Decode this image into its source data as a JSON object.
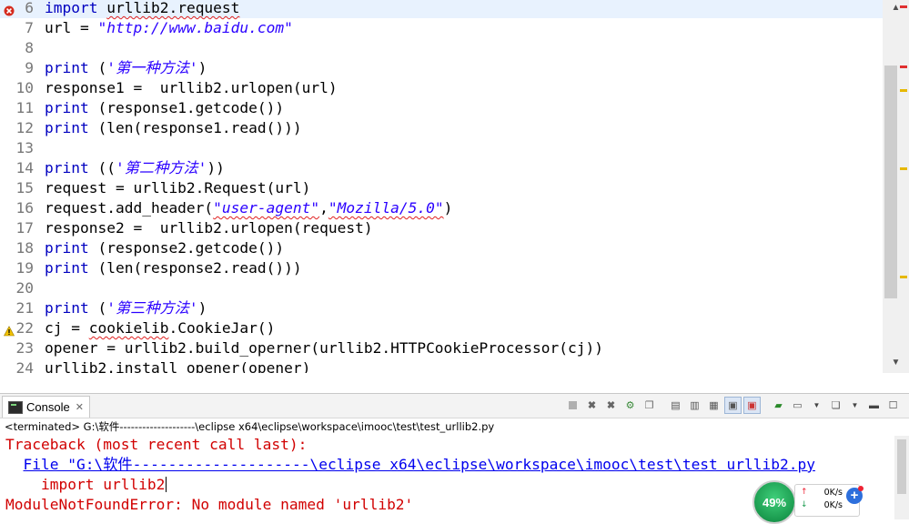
{
  "editor": {
    "lines": [
      {
        "n": "6",
        "parts": [
          {
            "t": "import",
            "c": "kw"
          },
          {
            "t": " "
          },
          {
            "t": "urllib2.request",
            "c": "err"
          }
        ],
        "marker": "error",
        "current": true
      },
      {
        "n": "7",
        "parts": [
          {
            "t": "url = "
          },
          {
            "t": "\"http://www.baidu.com\"",
            "c": "str"
          }
        ]
      },
      {
        "n": "8",
        "parts": []
      },
      {
        "n": "9",
        "parts": [
          {
            "t": "print",
            "c": "kw"
          },
          {
            "t": " ("
          },
          {
            "t": "'第一种方法'",
            "c": "str"
          },
          {
            "t": ")"
          }
        ]
      },
      {
        "n": "10",
        "parts": [
          {
            "t": "response1 =  urllib2.urlopen(url)"
          }
        ]
      },
      {
        "n": "11",
        "parts": [
          {
            "t": "print",
            "c": "kw"
          },
          {
            "t": " (response1.getcode())"
          }
        ]
      },
      {
        "n": "12",
        "parts": [
          {
            "t": "print",
            "c": "kw"
          },
          {
            "t": " (len(response1.read()))"
          }
        ]
      },
      {
        "n": "13",
        "parts": []
      },
      {
        "n": "14",
        "parts": [
          {
            "t": "print",
            "c": "kw"
          },
          {
            "t": " (("
          },
          {
            "t": "'第二种方法'",
            "c": "str"
          },
          {
            "t": "))"
          }
        ]
      },
      {
        "n": "15",
        "parts": [
          {
            "t": "request = urllib2.Request(url)"
          }
        ]
      },
      {
        "n": "16",
        "parts": [
          {
            "t": "request.add_header("
          },
          {
            "t": "\"user-agent\"",
            "c": "str err"
          },
          {
            "t": ","
          },
          {
            "t": "\"Mozilla/5.0\"",
            "c": "str err"
          },
          {
            "t": ")"
          }
        ]
      },
      {
        "n": "17",
        "parts": [
          {
            "t": "response2 =  urllib2.urlopen(request)"
          }
        ]
      },
      {
        "n": "18",
        "parts": [
          {
            "t": "print",
            "c": "kw"
          },
          {
            "t": " (response2.getcode())"
          }
        ]
      },
      {
        "n": "19",
        "parts": [
          {
            "t": "print",
            "c": "kw"
          },
          {
            "t": " (len(response2.read()))"
          }
        ]
      },
      {
        "n": "20",
        "parts": []
      },
      {
        "n": "21",
        "parts": [
          {
            "t": "print",
            "c": "kw"
          },
          {
            "t": " ("
          },
          {
            "t": "'第三种方法'",
            "c": "str"
          },
          {
            "t": ")"
          }
        ]
      },
      {
        "n": "22",
        "parts": [
          {
            "t": "cj = "
          },
          {
            "t": "cookielib",
            "c": "err"
          },
          {
            "t": ".CookieJar()"
          }
        ],
        "marker": "warning"
      },
      {
        "n": "23",
        "parts": [
          {
            "t": "opener = urllib2.build_operner(urllib2.HTTPCookieProcessor(cj))"
          }
        ]
      },
      {
        "n": "24",
        "parts": [
          {
            "t": "urllib2.install_opener(opener)"
          }
        ]
      }
    ]
  },
  "console": {
    "tab_label": "Console",
    "tab_close": "✕",
    "status": "<terminated> G:\\软件--------------------\\eclipse x64\\eclipse\\workspace\\imooc\\test\\test_urllib2.py",
    "output": [
      {
        "text": "Traceback (most recent call last):",
        "kind": "err"
      },
      {
        "text": "  ",
        "link": "File \"G:\\软件--------------------\\eclipse x64\\eclipse\\workspace\\imooc\\test\\test urllib2.py",
        "kind": "link"
      },
      {
        "text": "    import urllib2",
        "kind": "err"
      },
      {
        "text": "ModuleNotFoundError: No module named 'urllib2'",
        "kind": "err"
      }
    ]
  },
  "speed_widget": {
    "percent": "49%",
    "upload": "0K/s",
    "download": "0K/s",
    "up_arrow": "↑",
    "down_arrow": "↓",
    "add": "+"
  },
  "colors": {
    "keyword": "#0000c0",
    "string": "#2a00ff",
    "error_text": "#d10000",
    "link_text": "#0000ee",
    "current_line": "#e8f2fe"
  }
}
